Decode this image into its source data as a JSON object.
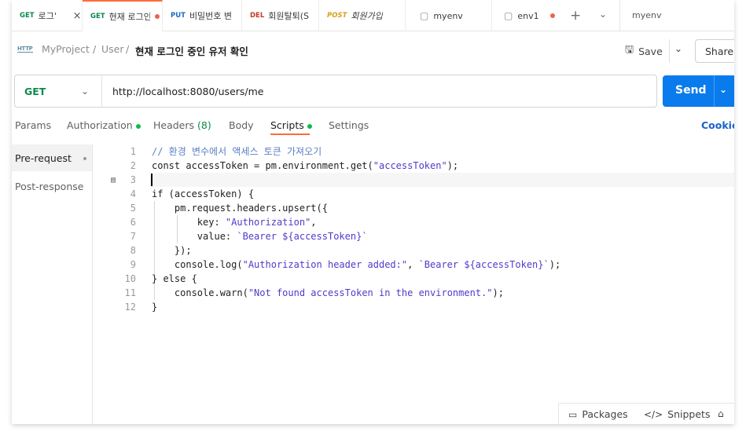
{
  "tabs": [
    {
      "method": "GET",
      "title": "로그'",
      "close": "×"
    },
    {
      "method": "GET",
      "title": "현재 로그인",
      "unsaved": true
    },
    {
      "method": "PUT",
      "title": "비밀번호 변"
    },
    {
      "method": "DEL",
      "title": "회원탈퇴(S"
    },
    {
      "method": "POST",
      "title": "회원가입"
    },
    {
      "icon": "▢",
      "title": "myenv"
    },
    {
      "icon": "▢",
      "title": "env1",
      "unsaved": true
    }
  ],
  "tabbar": {
    "plus": "+",
    "chevron": "⌄",
    "environment": "myenv"
  },
  "breadcrumb": {
    "icon": "HTTP",
    "project": "MyProject",
    "sep1": "/",
    "folder": "User",
    "sep2": "/",
    "current": "현재 로그인 중인 유저 확인"
  },
  "actions": {
    "save_icon": "🖫",
    "save": "Save",
    "save_chevron": "⌄",
    "share": "Share"
  },
  "request": {
    "method": "GET",
    "method_chevron": "⌄",
    "url": "http://localhost:8080/users/me",
    "send": "Send",
    "send_chevron": "⌄"
  },
  "request_tabs": [
    {
      "label": "Params"
    },
    {
      "label": "Authorization",
      "dot": true
    },
    {
      "label": "Headers",
      "count": "(8)"
    },
    {
      "label": "Body"
    },
    {
      "label": "Scripts",
      "dot": true,
      "active": true
    },
    {
      "label": "Settings"
    }
  ],
  "cookies": "Cookies",
  "scripts_side": {
    "pre_request": "Pre-request",
    "post_response": "Post-response"
  },
  "editor": {
    "comment_icon": "▤",
    "line_numbers": [
      "1",
      "2",
      "3",
      "4",
      "5",
      "6",
      "7",
      "8",
      "9",
      "10",
      "11",
      "12"
    ],
    "lines": [
      [
        {
          "t": "// 환경 변수에서 액세스 토큰 가져오기",
          "c": "cm"
        }
      ],
      [
        {
          "t": "const accessToken = pm.environment.get(",
          "c": "kw"
        },
        {
          "t": "\"accessToken\"",
          "c": "str"
        },
        {
          "t": ");",
          "c": "kw"
        }
      ],
      [],
      [
        {
          "t": "if (accessToken) {",
          "c": "kw"
        }
      ],
      [
        {
          "t": "    pm.request.headers.upsert({",
          "c": "kw"
        }
      ],
      [
        {
          "t": "        key: ",
          "c": "kw"
        },
        {
          "t": "\"Authorization\"",
          "c": "str"
        },
        {
          "t": ",",
          "c": "kw"
        }
      ],
      [
        {
          "t": "        value: ",
          "c": "kw"
        },
        {
          "t": "`Bearer ${accessToken}`",
          "c": "str"
        }
      ],
      [
        {
          "t": "    });",
          "c": "kw"
        }
      ],
      [
        {
          "t": "    console.log(",
          "c": "kw"
        },
        {
          "t": "\"Authorization header added:\"",
          "c": "str"
        },
        {
          "t": ", ",
          "c": "kw"
        },
        {
          "t": "`Bearer ${accessToken}`",
          "c": "str"
        },
        {
          "t": ");",
          "c": "kw"
        }
      ],
      [
        {
          "t": "} else {",
          "c": "kw"
        }
      ],
      [
        {
          "t": "    console.warn(",
          "c": "kw"
        },
        {
          "t": "\"Not found accessToken in the environment.\"",
          "c": "str"
        },
        {
          "t": ");",
          "c": "kw"
        }
      ],
      [
        {
          "t": "}",
          "c": "kw"
        }
      ]
    ]
  },
  "footer": {
    "packages_icon": "▭",
    "packages": "Packages",
    "snippets_icon": "</>",
    "snippets": "Snippets",
    "broom_icon": "⌂"
  }
}
